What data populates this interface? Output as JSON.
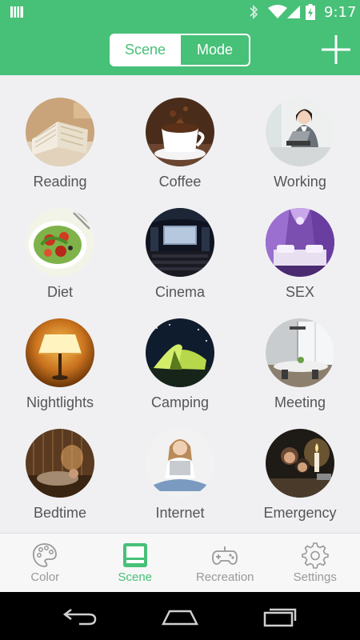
{
  "status_bar": {
    "time": "9:17"
  },
  "header": {
    "segments": [
      {
        "label": "Scene",
        "active": true
      },
      {
        "label": "Mode",
        "active": false
      }
    ],
    "add_icon": "plus-icon"
  },
  "scenes": [
    {
      "label": "Reading",
      "icon": "reading-photo"
    },
    {
      "label": "Coffee",
      "icon": "coffee-photo"
    },
    {
      "label": "Working",
      "icon": "working-photo"
    },
    {
      "label": "Diet",
      "icon": "diet-photo"
    },
    {
      "label": "Cinema",
      "icon": "cinema-photo"
    },
    {
      "label": "SEX",
      "icon": "bedroom-photo"
    },
    {
      "label": "Nightlights",
      "icon": "lamp-photo"
    },
    {
      "label": "Camping",
      "icon": "tent-photo"
    },
    {
      "label": "Meeting",
      "icon": "meeting-photo"
    },
    {
      "label": "Bedtime",
      "icon": "bedtime-photo"
    },
    {
      "label": "Internet",
      "icon": "laptop-photo"
    },
    {
      "label": "Emergency",
      "icon": "candle-photo"
    }
  ],
  "tabs": [
    {
      "label": "Color",
      "icon": "palette-icon",
      "active": false
    },
    {
      "label": "Scene",
      "icon": "scene-icon",
      "active": true
    },
    {
      "label": "Recreation",
      "icon": "gamepad-icon",
      "active": false
    },
    {
      "label": "Settings",
      "icon": "gear-icon",
      "active": false
    }
  ],
  "colors": {
    "accent": "#47c078",
    "background": "#f0f0f3",
    "label": "#555555",
    "tab_inactive": "#999999"
  }
}
